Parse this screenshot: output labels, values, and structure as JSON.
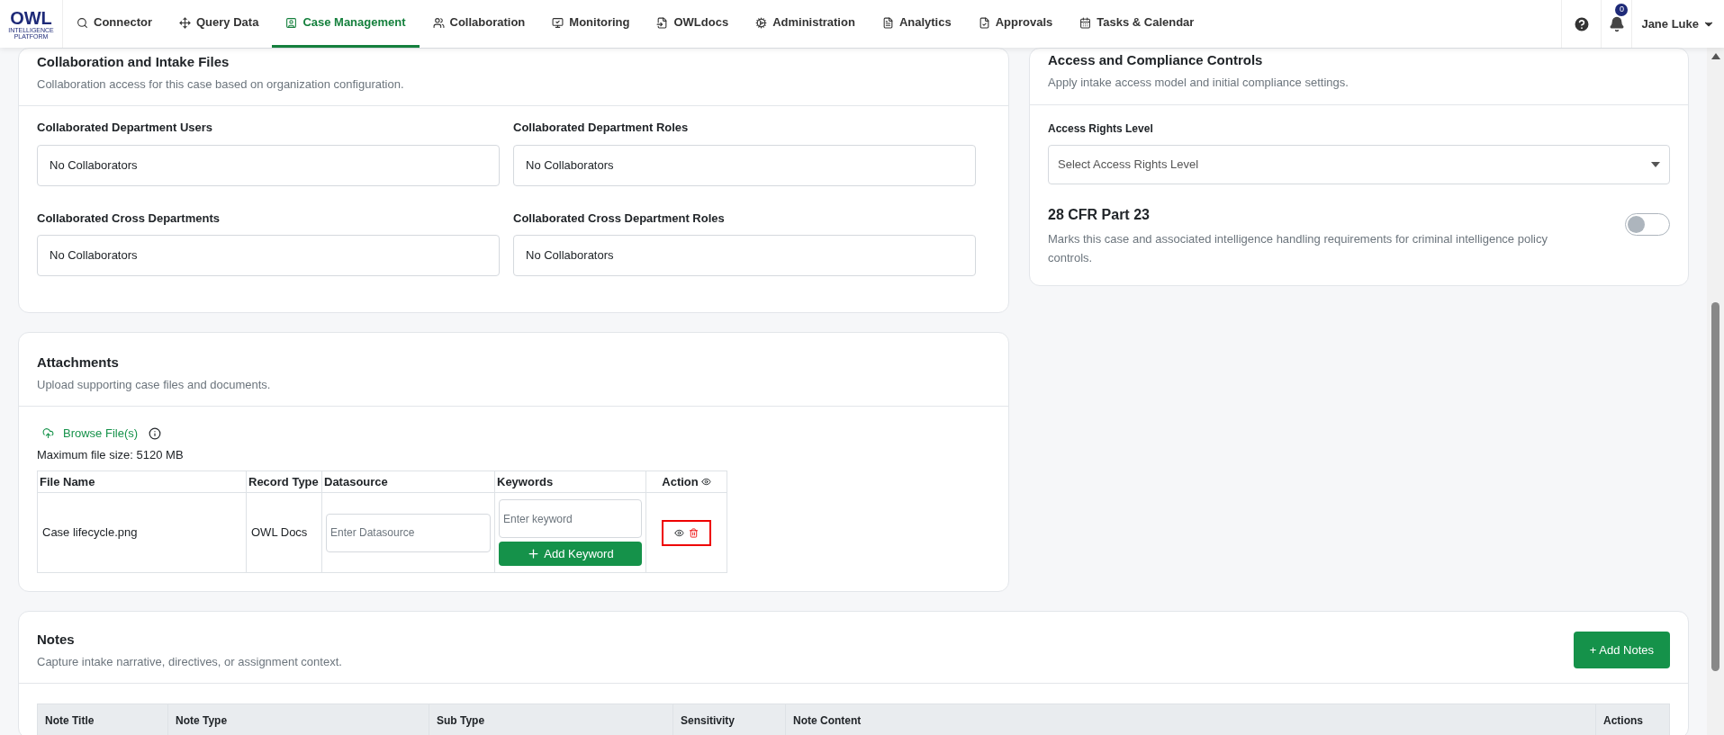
{
  "nav": {
    "logo": {
      "text": "OWL",
      "subtitle": "INTELLIGENCE PLATFORM"
    },
    "items": [
      {
        "label": "Connector",
        "selected": false
      },
      {
        "label": "Query Data",
        "selected": false
      },
      {
        "label": "Case Management",
        "selected": true
      },
      {
        "label": "Collaboration",
        "selected": false
      },
      {
        "label": "Monitoring",
        "selected": false
      },
      {
        "label": "OWLdocs",
        "selected": false
      },
      {
        "label": "Administration",
        "selected": false
      },
      {
        "label": "Analytics",
        "selected": false
      },
      {
        "label": "Approvals",
        "selected": false
      },
      {
        "label": "Tasks & Calendar",
        "selected": false
      }
    ],
    "notification_count": "0",
    "user": "Jane Luke"
  },
  "collaboration": {
    "title": "Collaboration and Intake Files",
    "subtitle": "Collaboration access for this case based on organization configuration.",
    "fields": [
      {
        "label": "Collaborated Department Users",
        "value": "No Collaborators"
      },
      {
        "label": "Collaborated Department Roles",
        "value": "No Collaborators"
      },
      {
        "label": "Collaborated Cross Departments",
        "value": "No Collaborators"
      },
      {
        "label": "Collaborated Cross Department Roles",
        "value": "No Collaborators"
      }
    ]
  },
  "attachments": {
    "title": "Attachments",
    "subtitle": "Upload supporting case files and documents.",
    "browse": "Browse File(s)",
    "max_size": "Maximum file size: 5120 MB",
    "columns": [
      "File Name",
      "Record Type",
      "Datasource",
      "Keywords",
      "Action"
    ],
    "rows": [
      {
        "file_name": "Case lifecycle.png",
        "record_type": "OWL Docs",
        "datasource_placeholder": "Enter Datasource",
        "keyword_placeholder": "Enter keyword",
        "add_keyword": "Add Keyword"
      }
    ]
  },
  "notes": {
    "title": "Notes",
    "subtitle": "Capture intake narrative, directives, or assignment context.",
    "add_button": "+ Add Notes",
    "columns": [
      "Note Title",
      "Note Type",
      "Sub Type",
      "Sensitivity",
      "Note Content",
      "Actions"
    ]
  },
  "access": {
    "title": "Access and Compliance Controls",
    "subtitle": "Apply intake access model and initial compliance settings.",
    "rights_label": "Access Rights Level",
    "rights_placeholder": "Select Access Rights Level",
    "cfr": {
      "title": "28 CFR Part 23",
      "description": "Marks this case and associated intelligence handling requirements for criminal intelligence policy controls.",
      "on": false
    }
  }
}
